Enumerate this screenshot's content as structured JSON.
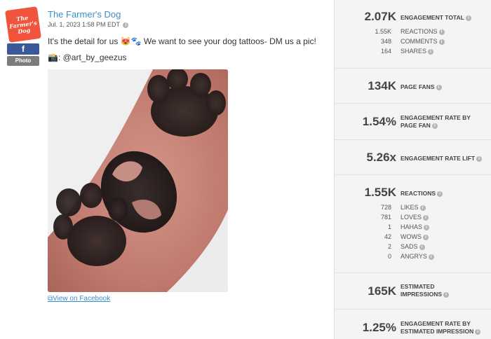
{
  "post": {
    "page_name": "The Farmer's Dog",
    "logo_lines": [
      "The",
      "Farmer's",
      "Dog"
    ],
    "facebook_glyph": "f",
    "media_type": "Photo",
    "date": "Jul. 1, 2023 1:58 PM EDT",
    "text": "It's the detail for us 😻🐾 We want to see your dog tattoos- DM us a pic!",
    "credit": "📸: @art_by_geezus",
    "view_link": "View on Facebook",
    "info_glyph": "i",
    "link_icon": "external-link-icon"
  },
  "metrics": {
    "engagement": {
      "value": "2.07K",
      "label": "ENGAGEMENT TOTAL",
      "rows": [
        {
          "value": "1.55K",
          "label": "REACTIONS"
        },
        {
          "value": "348",
          "label": "COMMENTS"
        },
        {
          "value": "164",
          "label": "SHARES"
        }
      ]
    },
    "page_fans": {
      "value": "134K",
      "label": "PAGE FANS"
    },
    "rate_by_fan": {
      "value": "1.54%",
      "label_1": "ENGAGEMENT RATE BY",
      "label_2": "PAGE FAN"
    },
    "rate_lift": {
      "value": "5.26x",
      "label": "ENGAGEMENT RATE LIFT"
    },
    "reactions": {
      "value": "1.55K",
      "label": "REACTIONS",
      "rows": [
        {
          "value": "728",
          "label": "LIKES"
        },
        {
          "value": "781",
          "label": "LOVES"
        },
        {
          "value": "1",
          "label": "HAHAS"
        },
        {
          "value": "42",
          "label": "WOWS"
        },
        {
          "value": "2",
          "label": "SADS"
        },
        {
          "value": "0",
          "label": "ANGRYS"
        }
      ]
    },
    "impressions": {
      "value": "165K",
      "label_1": "ESTIMATED",
      "label_2": "IMPRESSIONS"
    },
    "rate_by_impression": {
      "value": "1.25%",
      "label_1": "ENGAGEMENT RATE BY",
      "label_2": "ESTIMATED IMPRESSION"
    }
  },
  "colors": {
    "brand_logo": "#f0543c",
    "facebook_blue": "#3b5998",
    "link_blue": "#3a8fc8",
    "panel_bg": "#f4f4f4"
  }
}
